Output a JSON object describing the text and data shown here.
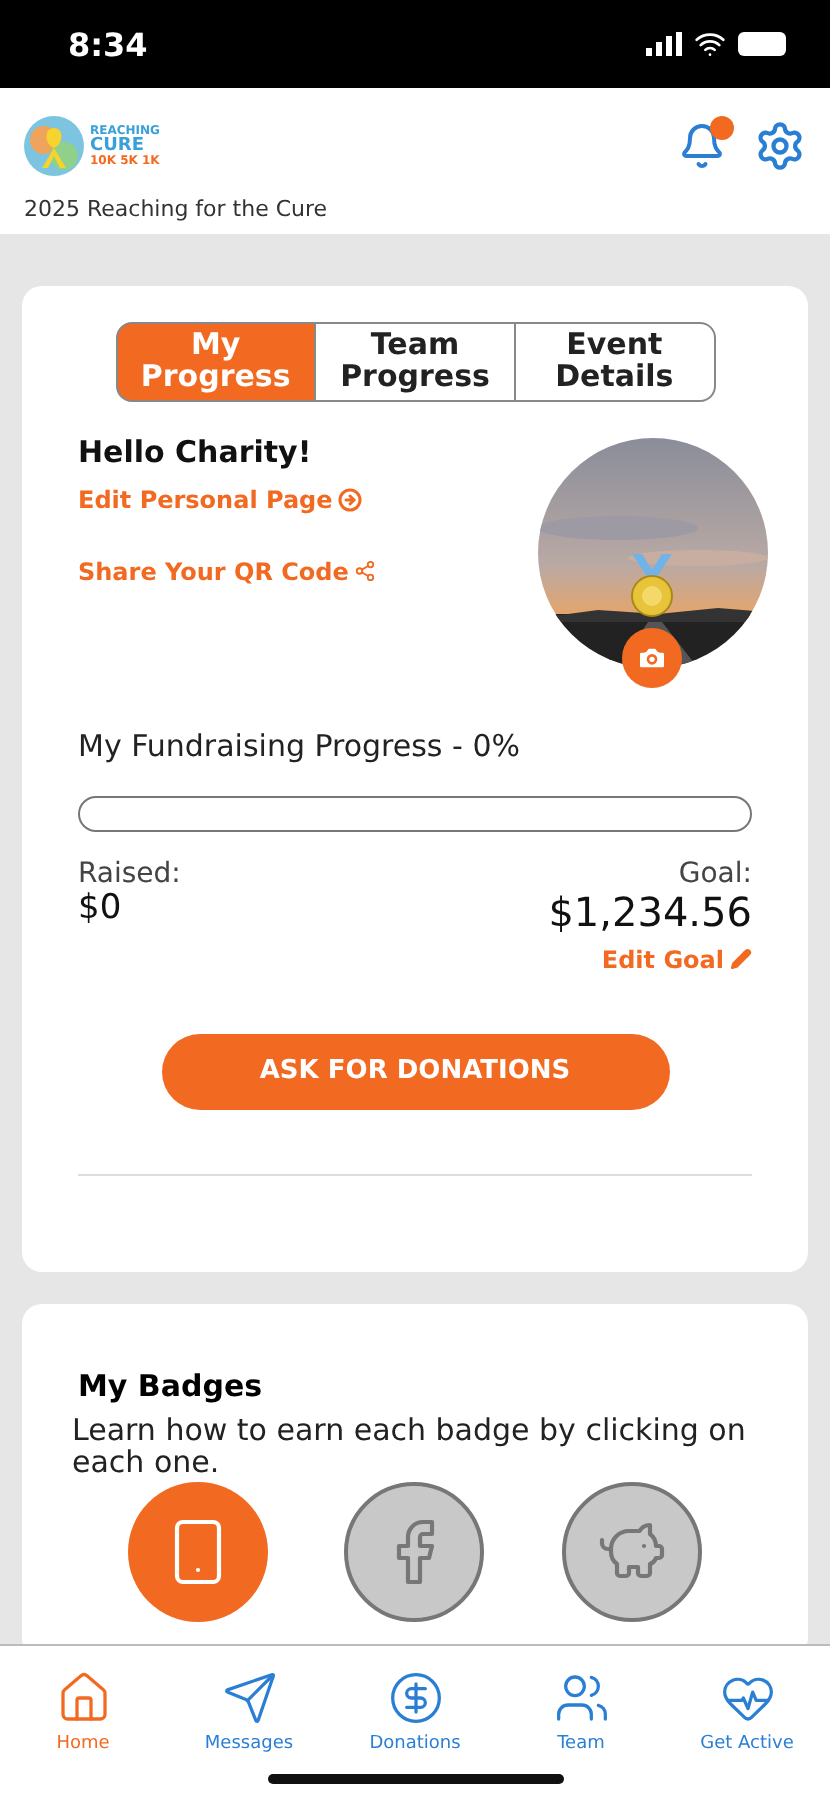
{
  "status_bar": {
    "time": "8:34"
  },
  "header": {
    "logo": {
      "lines": [
        "REACHING",
        "CURE",
        "10K 5K 1K"
      ]
    },
    "notifications": {
      "unread": true
    },
    "event_title": "2025 Reaching for the Cure"
  },
  "tabs": [
    {
      "label": "My Progress",
      "selected": true
    },
    {
      "label": "Team Progress",
      "selected": false
    },
    {
      "label": "Event Details",
      "selected": false
    }
  ],
  "profile": {
    "greeting": "Hello Charity!",
    "edit_link": "Edit Personal Page",
    "share_link": "Share Your QR Code"
  },
  "fundraising": {
    "title": "My Fundraising Progress - 0%",
    "level": 0,
    "raised_label": "Raised:",
    "raised": "$0",
    "goal_label": "Goal:",
    "goal": "$1,234.56",
    "edit_goal": "Edit Goal"
  },
  "donate_button": "ASK FOR DONATIONS",
  "badges": {
    "title": "My Badges",
    "description": "Learn how to earn each badge by clicking on each one.",
    "items": [
      {
        "kind": "phone",
        "earned": true
      },
      {
        "kind": "facebook",
        "earned": false
      },
      {
        "kind": "piggy",
        "earned": false
      }
    ]
  },
  "nav": [
    {
      "label": "Home",
      "kind": "home",
      "selected": true
    },
    {
      "label": "Messages",
      "kind": "messages",
      "selected": false
    },
    {
      "label": "Donations",
      "kind": "donations",
      "selected": false
    },
    {
      "label": "Team",
      "kind": "team",
      "selected": false
    },
    {
      "label": "Get Active",
      "kind": "active",
      "selected": false
    }
  ]
}
